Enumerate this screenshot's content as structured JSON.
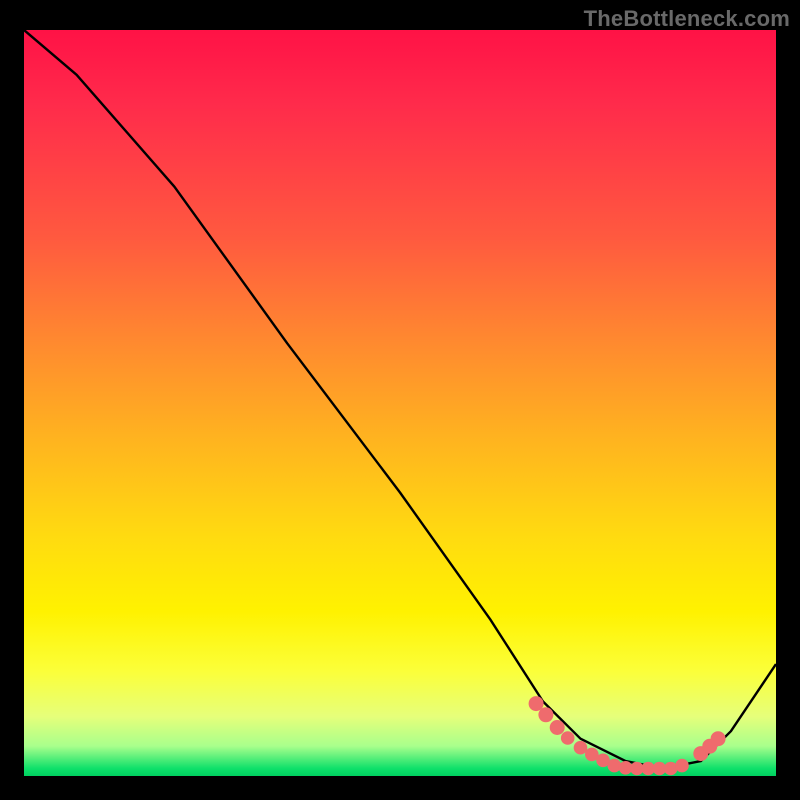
{
  "attribution": "TheBottleneck.com",
  "chart_data": {
    "type": "line",
    "title": "",
    "subtitle": "",
    "xlabel": "",
    "ylabel": "",
    "xlim": [
      0,
      1
    ],
    "ylim": [
      0,
      1
    ],
    "legend": false,
    "grid": false,
    "background": "gradient red(top) → yellow → green(bottom)",
    "series": [
      {
        "name": "bottleneck-curve",
        "color": "#000000",
        "x": [
          0.0,
          0.07,
          0.2,
          0.35,
          0.5,
          0.62,
          0.69,
          0.74,
          0.8,
          0.85,
          0.9,
          0.94,
          1.0
        ],
        "y": [
          1.0,
          0.94,
          0.79,
          0.58,
          0.38,
          0.21,
          0.1,
          0.05,
          0.02,
          0.01,
          0.02,
          0.06,
          0.15
        ],
        "note": "y is relative height above bottom; 1.0 = top, 0.0 = bottom. Minimum valley around x≈0.82–0.88."
      }
    ],
    "markers": {
      "name": "highlight-dots",
      "color": "#ef6b6d",
      "note": "Pink dots clustered along the valley of the curve",
      "points": [
        {
          "x": 0.681,
          "y": 0.097
        },
        {
          "x": 0.694,
          "y": 0.082
        },
        {
          "x": 0.709,
          "y": 0.065
        },
        {
          "x": 0.723,
          "y": 0.051
        },
        {
          "x": 0.74,
          "y": 0.038
        },
        {
          "x": 0.755,
          "y": 0.029
        },
        {
          "x": 0.77,
          "y": 0.021
        },
        {
          "x": 0.785,
          "y": 0.014
        },
        {
          "x": 0.8,
          "y": 0.011
        },
        {
          "x": 0.815,
          "y": 0.01
        },
        {
          "x": 0.83,
          "y": 0.01
        },
        {
          "x": 0.845,
          "y": 0.01
        },
        {
          "x": 0.86,
          "y": 0.01
        },
        {
          "x": 0.875,
          "y": 0.014
        },
        {
          "x": 0.9,
          "y": 0.03
        },
        {
          "x": 0.912,
          "y": 0.04
        },
        {
          "x": 0.923,
          "y": 0.05
        }
      ]
    }
  },
  "colors": {
    "background_black": "#000000",
    "attribution_text": "#696969",
    "curve_stroke": "#000000",
    "marker_fill": "#ef6b6d",
    "gradient_top": "#ff1246",
    "gradient_bottom": "#00d060"
  }
}
